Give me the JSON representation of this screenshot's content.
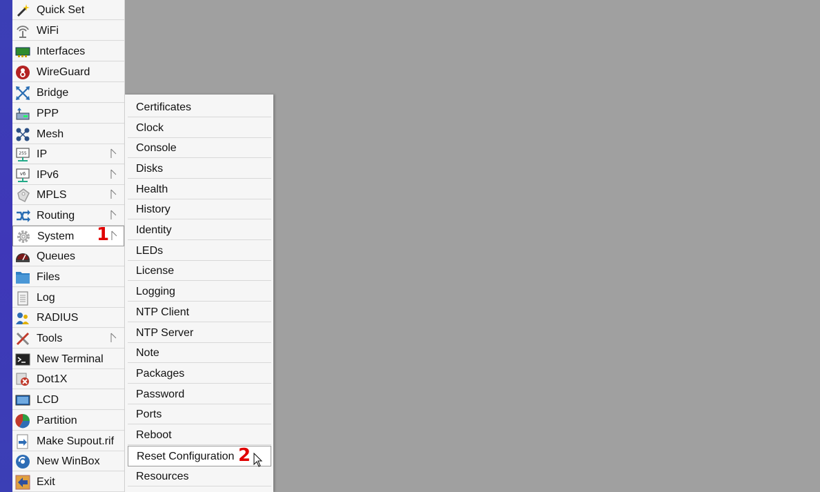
{
  "main_menu": {
    "items": [
      {
        "label": "Quick Set",
        "icon": "magic-wand-icon",
        "has_submenu": false
      },
      {
        "label": "WiFi",
        "icon": "wifi-antenna-icon",
        "has_submenu": false
      },
      {
        "label": "Interfaces",
        "icon": "network-card-icon",
        "has_submenu": false
      },
      {
        "label": "WireGuard",
        "icon": "wireguard-icon",
        "has_submenu": false
      },
      {
        "label": "Bridge",
        "icon": "bridge-icon",
        "has_submenu": false
      },
      {
        "label": "PPP",
        "icon": "ppp-icon",
        "has_submenu": false
      },
      {
        "label": "Mesh",
        "icon": "mesh-icon",
        "has_submenu": false
      },
      {
        "label": "IP",
        "icon": "ip-monitor-icon",
        "has_submenu": true
      },
      {
        "label": "IPv6",
        "icon": "ipv6-monitor-icon",
        "has_submenu": true
      },
      {
        "label": "MPLS",
        "icon": "mpls-icon",
        "has_submenu": true
      },
      {
        "label": "Routing",
        "icon": "routing-icon",
        "has_submenu": true
      },
      {
        "label": "System",
        "icon": "gear-icon",
        "has_submenu": true,
        "selected": true
      },
      {
        "label": "Queues",
        "icon": "queues-gauge-icon",
        "has_submenu": false
      },
      {
        "label": "Files",
        "icon": "folder-icon",
        "has_submenu": false
      },
      {
        "label": "Log",
        "icon": "log-notepad-icon",
        "has_submenu": false
      },
      {
        "label": "RADIUS",
        "icon": "radius-users-icon",
        "has_submenu": false
      },
      {
        "label": "Tools",
        "icon": "tools-icon",
        "has_submenu": true
      },
      {
        "label": "New Terminal",
        "icon": "terminal-icon",
        "has_submenu": false
      },
      {
        "label": "Dot1X",
        "icon": "dot1x-icon",
        "has_submenu": false
      },
      {
        "label": "LCD",
        "icon": "lcd-screen-icon",
        "has_submenu": false
      },
      {
        "label": "Partition",
        "icon": "pie-partition-icon",
        "has_submenu": false
      },
      {
        "label": "Make Supout.rif",
        "icon": "supout-file-icon",
        "has_submenu": false
      },
      {
        "label": "New WinBox",
        "icon": "winbox-icon",
        "has_submenu": false
      },
      {
        "label": "Exit",
        "icon": "exit-icon",
        "has_submenu": false
      }
    ]
  },
  "system_submenu": {
    "items": [
      {
        "label": "Certificates"
      },
      {
        "label": "Clock"
      },
      {
        "label": "Console"
      },
      {
        "label": "Disks"
      },
      {
        "label": "Health"
      },
      {
        "label": "History"
      },
      {
        "label": "Identity"
      },
      {
        "label": "LEDs"
      },
      {
        "label": "License"
      },
      {
        "label": "Logging"
      },
      {
        "label": "NTP Client"
      },
      {
        "label": "NTP Server"
      },
      {
        "label": "Note"
      },
      {
        "label": "Packages"
      },
      {
        "label": "Password"
      },
      {
        "label": "Ports"
      },
      {
        "label": "Reboot"
      },
      {
        "label": "Reset Configuration",
        "selected": true
      },
      {
        "label": "Resources"
      }
    ]
  },
  "annotations": {
    "step1": "1",
    "step2": "2"
  },
  "colors": {
    "desktop": "#a0a0a0",
    "left_strip": "#3b3fb5",
    "menu_bg": "#f6f6f6",
    "annotation_red": "#e00000"
  }
}
